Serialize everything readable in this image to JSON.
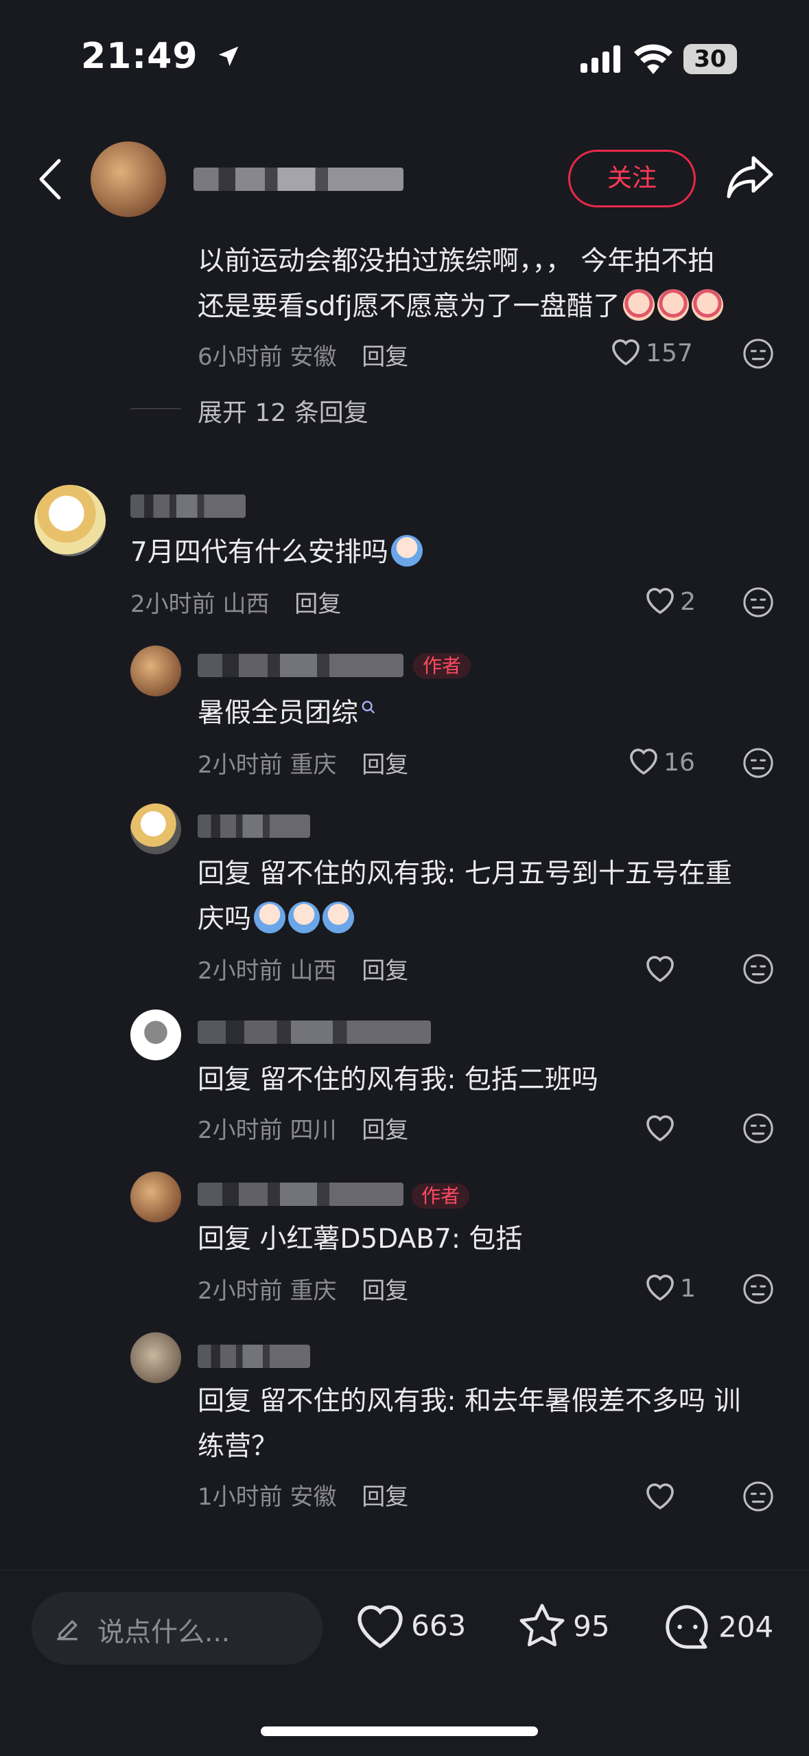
{
  "status_bar": {
    "time": "21:49",
    "battery": "30"
  },
  "header": {
    "follow_label": "关注"
  },
  "top_comment": {
    "text_line1": "以前运动会都没拍过族综啊，，，  今年拍不拍",
    "text_line2": "还是要看sdfj愿不愿意为了一盘醋了",
    "time": "6小时前",
    "location": "安徽",
    "reply_label": "回复",
    "likes": "157",
    "expand_label": "展开 12 条回复"
  },
  "comments": [
    {
      "text": "7月四代有什么安排吗",
      "time": "2小时前",
      "location": "山西",
      "reply_label": "回复",
      "likes": "2"
    }
  ],
  "replies": [
    {
      "author_tag": "作者",
      "text": "暑假全员团综",
      "time": "2小时前",
      "location": "重庆",
      "reply_label": "回复",
      "likes": "16"
    },
    {
      "text_line1": "回复 留不住的风有我: 七月五号到十五号在重",
      "text_line2": "庆吗",
      "time": "2小时前",
      "location": "山西",
      "reply_label": "回复",
      "likes": ""
    },
    {
      "text": "回复 留不住的风有我: 包括二班吗",
      "time": "2小时前",
      "location": "四川",
      "reply_label": "回复",
      "likes": ""
    },
    {
      "author_tag": "作者",
      "text": "回复 小红薯D5DAB7: 包括",
      "time": "2小时前",
      "location": "重庆",
      "reply_label": "回复",
      "likes": "1"
    },
    {
      "text_line1": "回复 留不住的风有我: 和去年暑假差不多吗 训",
      "text_line2": "练营？",
      "time": "1小时前",
      "location": "安徽",
      "reply_label": "回复",
      "likes": ""
    }
  ],
  "bottom_bar": {
    "input_placeholder": "说点什么...",
    "likes": "663",
    "favorites": "95",
    "comments": "204"
  },
  "colors": {
    "background": "#191a1f",
    "accent": "#ff3a57"
  },
  "icons": [
    "back-icon",
    "share-icon",
    "heart-icon",
    "dismiss-face-icon",
    "pencil-icon",
    "star-icon",
    "comment-bubble-icon",
    "location-arrow-icon",
    "signal-icon",
    "wifi-icon"
  ]
}
